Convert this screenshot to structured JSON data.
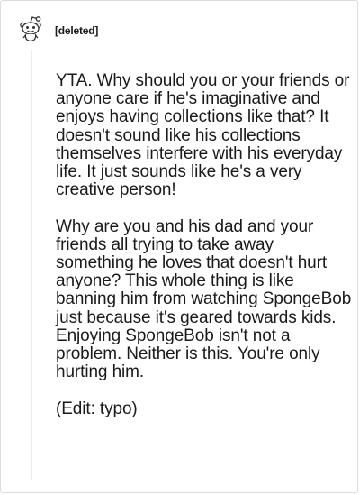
{
  "comment": {
    "author": "[deleted]",
    "avatar_icon": "reddit-snoo-icon",
    "paragraphs": [
      "YTA. Why should you or your friends or anyone care if he's imaginative and enjoys having collections like that? It doesn't sound like his collections themselves interfere with his everyday life. It just sounds like he's a very creative person!",
      "Why are you and his dad and your friends all trying to take away something he loves that doesn't hurt anyone? This whole thing is like banning him from watching SpongeBob just because it's geared towards kids. Enjoying SpongeBob isn't not a problem. Neither is this. You're only hurting him.",
      "(Edit: typo)"
    ]
  },
  "colors": {
    "text": "#1a1a1b",
    "thread_line": "#ebebeb",
    "border": "#dcdcdc"
  }
}
